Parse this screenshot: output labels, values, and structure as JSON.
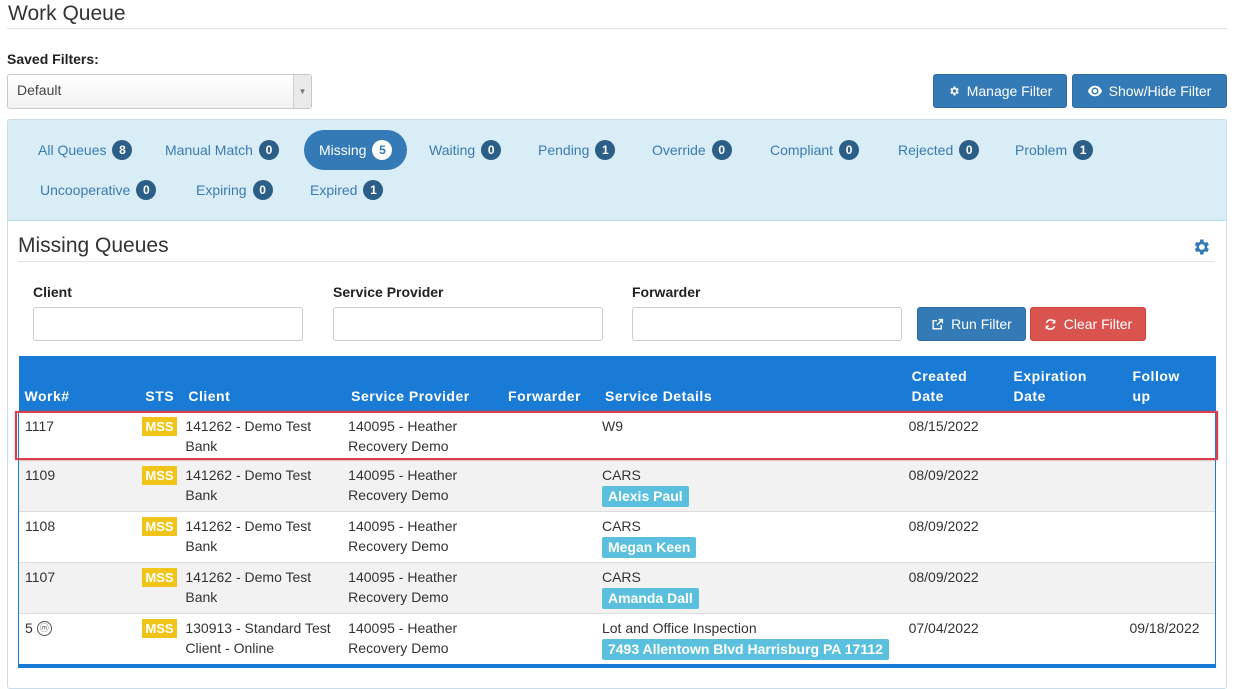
{
  "page": {
    "title": "Work Queue"
  },
  "filters": {
    "saved_label": "Saved Filters:",
    "saved_value": "Default"
  },
  "buttons": {
    "manage_filter": "Manage Filter",
    "show_hide_filter": "Show/Hide Filter",
    "run_filter": "Run Filter",
    "clear_filter": "Clear Filter"
  },
  "tabs": [
    {
      "label": "All Queues",
      "count": "8"
    },
    {
      "label": "Manual Match",
      "count": "0"
    },
    {
      "label": "Missing",
      "count": "5",
      "active": true
    },
    {
      "label": "Waiting",
      "count": "0"
    },
    {
      "label": "Pending",
      "count": "1"
    },
    {
      "label": "Override",
      "count": "0"
    },
    {
      "label": "Compliant",
      "count": "0"
    },
    {
      "label": "Rejected",
      "count": "0"
    },
    {
      "label": "Problem",
      "count": "1"
    },
    {
      "label": "Uncooperative",
      "count": "0"
    },
    {
      "label": "Expiring",
      "count": "0"
    },
    {
      "label": "Expired",
      "count": "1"
    }
  ],
  "section": {
    "title": "Missing Queues"
  },
  "search": {
    "client_label": "Client",
    "provider_label": "Service Provider",
    "forwarder_label": "Forwarder"
  },
  "table": {
    "headers": {
      "work": "Work#",
      "sts": "STS",
      "client": "Client",
      "provider": "Service Provider",
      "forwarder": "Forwarder",
      "details": "Service Details",
      "created_1": "Created",
      "created_2": "Date",
      "expiration_1": "Expiration",
      "expiration_2": "Date",
      "follow_1": "Follow",
      "follow_2": "up"
    },
    "rows": [
      {
        "work": "1117",
        "sts": "MSS",
        "client_1": "141262 - Demo Test",
        "client_2": "Bank",
        "provider_1": "140095 - Heather",
        "provider_2": "Recovery Demo",
        "forwarder": "",
        "detail": "W9",
        "tag": "",
        "created": "08/15/2022",
        "expiration": "",
        "follow": ""
      },
      {
        "work": "1109",
        "sts": "MSS",
        "client_1": "141262 - Demo Test",
        "client_2": "Bank",
        "provider_1": "140095 - Heather",
        "provider_2": "Recovery Demo",
        "forwarder": "",
        "detail": "CARS",
        "tag": "Alexis Paul",
        "created": "08/09/2022",
        "expiration": "",
        "follow": ""
      },
      {
        "work": "1108",
        "sts": "MSS",
        "client_1": "141262 - Demo Test",
        "client_2": "Bank",
        "provider_1": "140095 - Heather",
        "provider_2": "Recovery Demo",
        "forwarder": "",
        "detail": "CARS",
        "tag": "Megan Keen",
        "created": "08/09/2022",
        "expiration": "",
        "follow": ""
      },
      {
        "work": "1107",
        "sts": "MSS",
        "client_1": "141262 - Demo Test",
        "client_2": "Bank",
        "provider_1": "140095 - Heather",
        "provider_2": "Recovery Demo",
        "forwarder": "",
        "detail": "CARS",
        "tag": "Amanda Dall",
        "created": "08/09/2022",
        "expiration": "",
        "follow": ""
      },
      {
        "work": "5",
        "work_icon": "ⓜ",
        "sts": "MSS",
        "client_1": "130913 - Standard Test",
        "client_2": "Client - Online",
        "provider_1": "140095 - Heather",
        "provider_2": "Recovery Demo",
        "forwarder": "",
        "detail": "Lot and Office Inspection",
        "tag": "7493 Allentown Blvd Harrisburg PA 17112",
        "created": "07/04/2022",
        "expiration": "",
        "follow": "09/18/2022"
      }
    ]
  },
  "icons": {
    "manage": "gear-icon",
    "show_hide": "eye-icon",
    "run": "external-link-icon",
    "clear": "refresh-icon",
    "settings": "gear-icon"
  },
  "colors": {
    "primary": "#337ab7",
    "danger": "#d9534f",
    "table_header": "#1a7bd6",
    "status": "#f0c419",
    "tag": "#5bc0de",
    "tabs_bg": "#d9edf7"
  }
}
